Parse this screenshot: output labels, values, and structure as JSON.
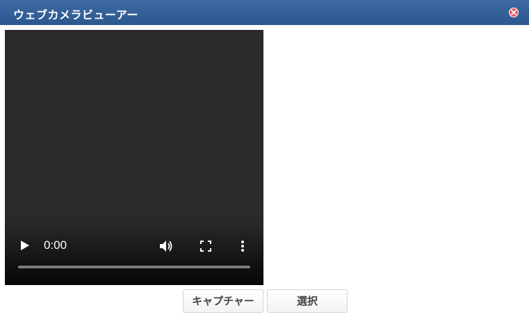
{
  "window": {
    "title": "ウェブカメラビューアー"
  },
  "video_player": {
    "current_time": "0:00",
    "progress": 0
  },
  "buttons": {
    "capture_label": "キャプチャー",
    "select_label": "選択"
  },
  "colors": {
    "titlebar": "#2f5b93",
    "close": "#ea5b5b",
    "video_bg": "#2a2a2a"
  },
  "icons": [
    "close-icon",
    "play-icon",
    "volume-icon",
    "fullscreen-icon",
    "more-options-icon"
  ]
}
